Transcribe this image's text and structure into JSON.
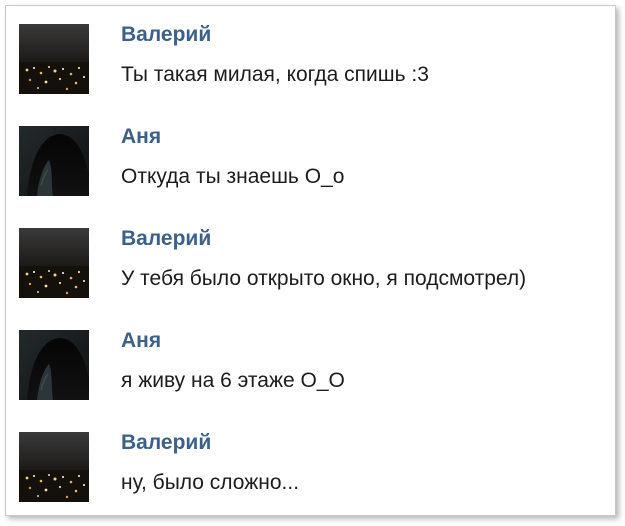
{
  "colors": {
    "author": "#3b6189",
    "text": "#1c1c1c",
    "border": "#c9c9c9"
  },
  "messages": [
    {
      "author": "Валерий",
      "text": "Ты такая милая, когда спишь :3",
      "avatar": "city-night-photo"
    },
    {
      "author": "Аня",
      "text": "Откуда ты знаешь О_о",
      "avatar": "dark-portrait-photo"
    },
    {
      "author": "Валерий",
      "text": "У тебя было открыто окно, я подсмотрел)",
      "avatar": "city-night-photo"
    },
    {
      "author": "Аня",
      "text": "я живу на 6 этаже О_О",
      "avatar": "dark-portrait-photo"
    },
    {
      "author": "Валерий",
      "text": "ну, было сложно...",
      "avatar": "city-night-photo"
    }
  ]
}
